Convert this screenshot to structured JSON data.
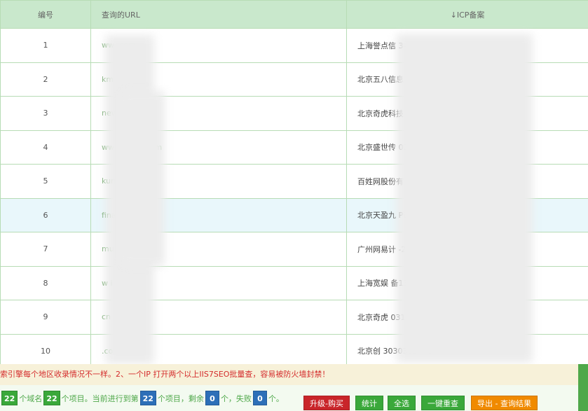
{
  "table": {
    "headers": {
      "num": "编号",
      "url": "查询的URL",
      "icp": "↓ICP备案"
    },
    "rows": [
      {
        "num": "1",
        "url": "ww        .com",
        "icp": "上海誉点信                               3-64"
      },
      {
        "num": "2",
        "url": "km.5",
        "icp": "北京五八信息                     012705号-2"
      },
      {
        "num": "3",
        "url": "news.ed",
        "icp": "北京奇虎科技                     010314号-6"
      },
      {
        "num": "4",
        "url": "www.meis              .com",
        "icp": "北京盛世传                          020153号-1"
      },
      {
        "num": "5",
        "url": "kunmin              .com",
        "icp": "百姓网股份有                        413号-1"
      },
      {
        "num": "6",
        "url": "finan               .com",
        "icp": "北京天盈九                    P证030609号-1"
      },
      {
        "num": "7",
        "url": "mu            .com",
        "icp": "广州网易计                     -20090191-18"
      },
      {
        "num": "8",
        "url": "w          i.com",
        "icp": "上海宽娱                     备13002172号-3"
      },
      {
        "num": "9",
        "url": "           cn",
        "icp": "北京奇虎                           0314号-6"
      },
      {
        "num": "10",
        "url": "           .com",
        "icp": "北京创                    3030338号-3"
      }
    ]
  },
  "warning": "索引擎每个地区收录情况不一样。2、一个IP 打开两个以上IIS7SEO批量查，容易被防火墙封禁！",
  "status": {
    "total": "22",
    "t1": "个域名",
    "items": "22",
    "t2": "个项目。当前进行到第",
    "current": "22",
    "t3": "个项目，剩余",
    "remaining": "0",
    "t4": "个，失败",
    "failed": "0",
    "t5": "个。"
  },
  "buttons": {
    "upgrade": "升级-购买",
    "stats": "统计",
    "select_all": "全选",
    "recheck": "一键重查",
    "export": "导出 - 查询结果"
  },
  "colors": {
    "header_bg": "#c9e8cc",
    "highlight_row": "#e9f7fb",
    "accent_green": "#3aa83a",
    "accent_blue": "#2d6fb8",
    "warning_red": "#d42d2d"
  }
}
